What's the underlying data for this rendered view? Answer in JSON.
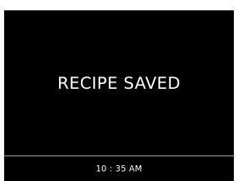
{
  "screen": {
    "message": "RECIPE SAVED",
    "status_bar": {
      "time": "10 : 35 AM"
    }
  },
  "colors": {
    "background": "#000000",
    "text": "#ffffff",
    "divider": "#bdbdbd"
  }
}
